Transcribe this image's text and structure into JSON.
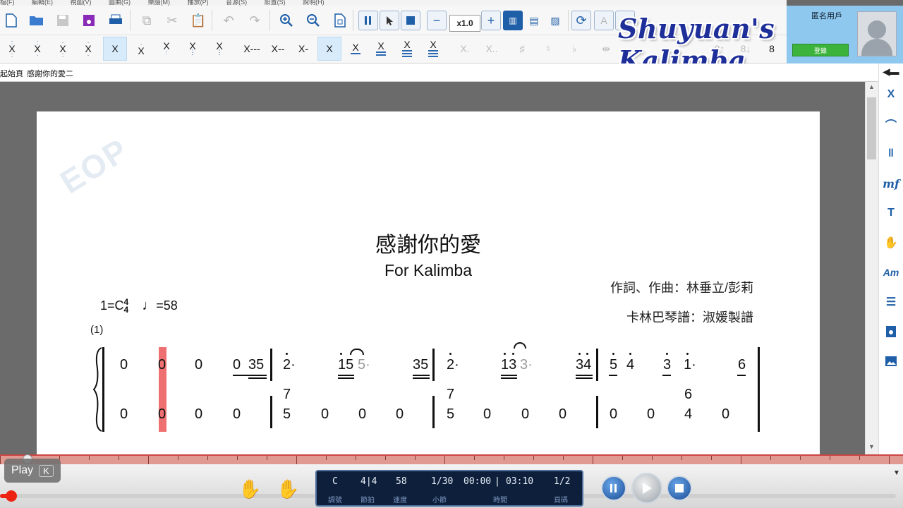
{
  "menu": [
    "檔(F)",
    "編輯(E)",
    "視圖(V)",
    "圖曲(G)",
    "樂譜(M)",
    "播放(P)",
    "音源(S)",
    "設置(S)",
    "說明(H)"
  ],
  "toolbar": {
    "speed": "x1.0"
  },
  "note_tools": {
    "value_buttons": [
      "X---",
      "X--",
      "X-",
      "X"
    ],
    "underline_buttons": [
      "X",
      "X",
      "X",
      "X"
    ],
    "dot_buttons": [
      "X.",
      "X.."
    ],
    "accidentals": [
      "♯",
      "♮",
      "♭"
    ],
    "octave_8": "8"
  },
  "user": {
    "name": "匿名用戶",
    "login_label": "登錄"
  },
  "watermark": "Shuyuan's Kalimba",
  "tabs": [
    "起始頁",
    "感謝你的愛二"
  ],
  "score": {
    "title": "感謝你的愛",
    "subtitle": "For Kalimba",
    "credit_composer": "作詞、作曲：林垂立/彭莉",
    "credit_arranger": "卡林巴琴譜：淑媛製譜",
    "key": "1=C",
    "time_top": "4",
    "time_bottom": "4",
    "tempo": "=58",
    "measure_number": "(1)",
    "watermark_logo": "EOP"
  },
  "status": {
    "key": "C",
    "meter": "4|4",
    "tempo": "58",
    "measure": "1/30",
    "time_current": "00:00",
    "time_total": "03:10",
    "page": "1/2",
    "labels": [
      "調號",
      "節拍",
      "速度",
      "小節",
      "時間",
      "頁碼"
    ]
  },
  "play": {
    "label": "Play",
    "key": "K"
  },
  "colors": {
    "accent": "#1f5fa8",
    "highlight": "#ee7070",
    "login": "#3cb43c",
    "status_bg": "#0d1f3a"
  }
}
